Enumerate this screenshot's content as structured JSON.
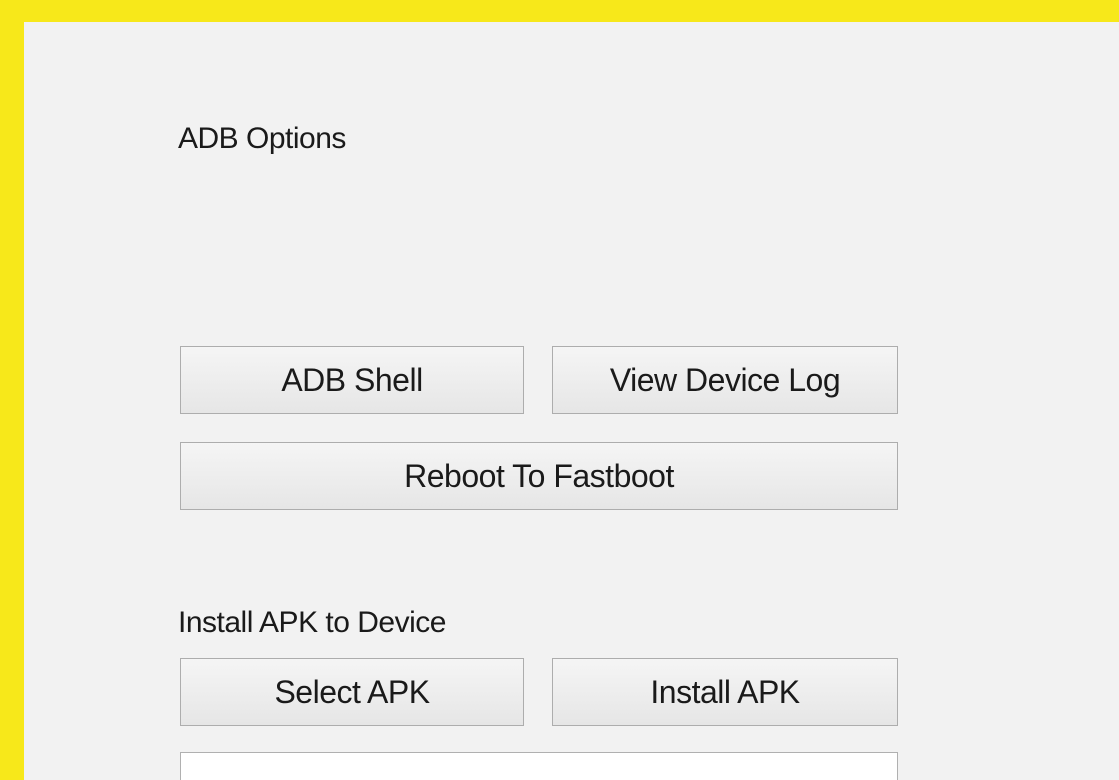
{
  "adb": {
    "section_label": "ADB Options",
    "shell_button": "ADB Shell",
    "device_log_button": "View Device Log",
    "reboot_fastboot_button": "Reboot To Fastboot"
  },
  "apk": {
    "section_label": "Install APK to Device",
    "select_button": "Select APK",
    "install_button": "Install APK",
    "path_value": ""
  },
  "colors": {
    "frame": "#f7e81a",
    "panel": "#f2f2f2",
    "button_border": "#adadad"
  }
}
